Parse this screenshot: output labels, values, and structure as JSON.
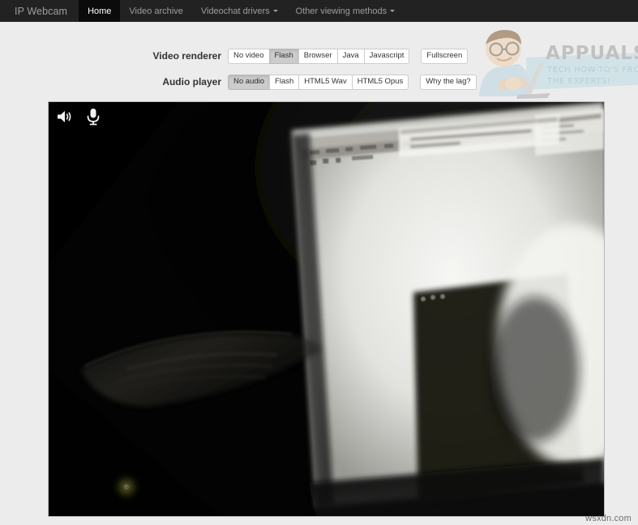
{
  "navbar": {
    "brand": "IP Webcam",
    "items": [
      {
        "label": "Home",
        "active": true,
        "dropdown": false
      },
      {
        "label": "Video archive",
        "active": false,
        "dropdown": false
      },
      {
        "label": "Videochat drivers",
        "active": false,
        "dropdown": true
      },
      {
        "label": "Other viewing methods",
        "active": false,
        "dropdown": true
      }
    ],
    "background_color": "#222222",
    "text_color": "#9d9d9d",
    "active_text_color": "#ffffff",
    "active_background_color": "#0b0b0b"
  },
  "controls": {
    "rows": [
      {
        "label": "Video renderer",
        "groups": [
          {
            "buttons": [
              {
                "label": "No video",
                "active": false
              },
              {
                "label": "Flash",
                "active": true
              },
              {
                "label": "Browser",
                "active": false
              },
              {
                "label": "Java",
                "active": false
              },
              {
                "label": "Javascript",
                "active": false
              }
            ]
          },
          {
            "buttons": [
              {
                "label": "Fullscreen",
                "active": false
              }
            ]
          }
        ]
      },
      {
        "label": "Audio player",
        "groups": [
          {
            "buttons": [
              {
                "label": "No audio",
                "active": true
              },
              {
                "label": "Flash",
                "active": false
              },
              {
                "label": "HTML5 Wav",
                "active": false
              },
              {
                "label": "HTML5 Opus",
                "active": false
              }
            ]
          },
          {
            "buttons": [
              {
                "label": "Why the lag?",
                "active": false
              }
            ]
          }
        ]
      }
    ]
  },
  "video": {
    "overlay_icons": [
      {
        "name": "speaker-icon",
        "label": "Speaker"
      },
      {
        "name": "microphone-icon",
        "label": "Microphone"
      }
    ],
    "description": "Dark room webcam view of a computer monitor showing a bright white window, a dim keyboard silhouette and a small yellow LED",
    "background_color": "#000000"
  },
  "watermark": {
    "title": "APPUALS",
    "tagline_line1": "TECH HOW-TO'S FROM",
    "tagline_line2": "THE EXPERTS!",
    "title_color": "#a8a8a8",
    "banner_color": "#bcdce4",
    "tagline_color": "#8fc0cd"
  },
  "site_watermark": {
    "text": "wsxdn.com",
    "color": "#6f6f6f"
  },
  "page": {
    "background_color": "#ececec"
  }
}
